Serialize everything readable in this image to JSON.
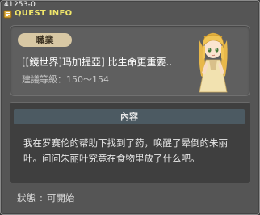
{
  "quest_id": "41253-0",
  "window_title": "QUEST INFO",
  "quest": {
    "job_badge": "職業",
    "title": "[[鏡世界]玛加提亞] 比生命更重要..",
    "req_level_label": "建議等級",
    "req_level_value": "150～154"
  },
  "content": {
    "header": "內容",
    "text": "我在罗赛伦的帮助下找到了药，唤醒了晕倒的朱丽叶。问问朱丽叶究竟在食物里放了什么吧。"
  },
  "status": {
    "label": "狀態",
    "value": "可開始"
  },
  "icons": {
    "title_icon": "quest-book-icon",
    "npc": "juliet-npc-portrait"
  },
  "colors": {
    "window_bg": "#555555",
    "title_yellow": "#f0e66a",
    "badge_bg": "#d8c8a4",
    "content_header_bg": "#4c5a62",
    "content_bg": "#3f3f3f"
  }
}
